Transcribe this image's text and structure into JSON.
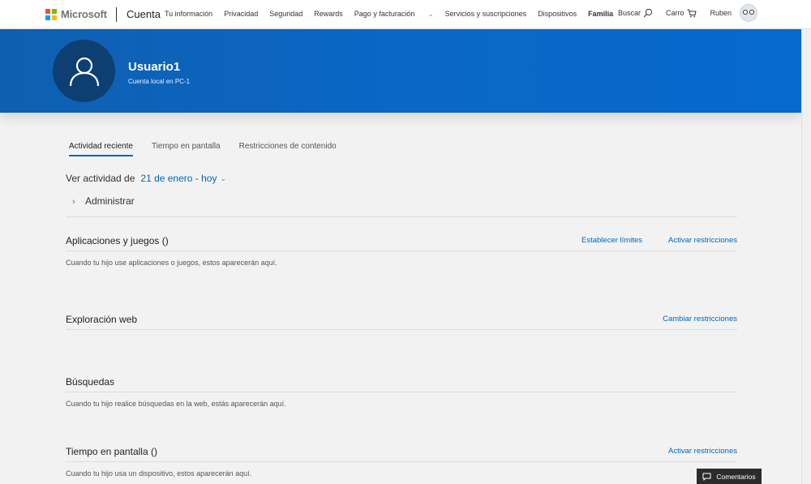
{
  "header": {
    "brand": "Microsoft",
    "section": "Cuenta",
    "nav_links": [
      {
        "label": "Tu información",
        "bold": false
      },
      {
        "label": "Privacidad",
        "bold": false
      },
      {
        "label": "Seguridad",
        "bold": false
      },
      {
        "label": "Rewards",
        "bold": false
      },
      {
        "label": "Pago y facturación",
        "bold": false,
        "dropdown": true
      },
      {
        "label": "Servicios y suscripciones",
        "bold": false
      },
      {
        "label": "Dispositivos",
        "bold": false
      },
      {
        "label": "Familia",
        "bold": true
      }
    ],
    "search_label": "Buscar",
    "cart_label": "Carro",
    "user_label": "Ruben",
    "icons": {
      "search": "search-icon",
      "cart": "cart-icon",
      "avatar": "avatar"
    }
  },
  "banner": {
    "name": "Usuario1",
    "subtitle": "Cuenta local en PC-1",
    "color": "#0a67c6"
  },
  "tabs": [
    {
      "label": "Actividad reciente",
      "active": true
    },
    {
      "label": "Tiempo en pantalla",
      "active": false
    },
    {
      "label": "Restricciones de contenido",
      "active": false
    }
  ],
  "activity": {
    "label": "Ver actividad de",
    "range": "21 de enero - hoy"
  },
  "admin": {
    "label": "Administrar"
  },
  "sections": {
    "apps": {
      "title": "Aplicaciones y juegos ()",
      "links": [
        "Establecer límites",
        "Activar restricciones"
      ],
      "body": "Cuando tu hijo use aplicaciones o juegos, estos aparecerán aquí."
    },
    "web": {
      "title": "Exploración web",
      "links": [
        "Cambiar restricciones"
      ],
      "body": ""
    },
    "search": {
      "title": "Búsquedas",
      "links": [],
      "body": "Cuando tu hijo realice búsquedas en la web, estás aparecerán aquí."
    },
    "screen": {
      "title": "Tiempo en pantalla ()",
      "links": [
        "Activar restricciones"
      ],
      "body": "Cuando tu hijo usa un dispositivo, estos aparecerán aquí."
    }
  },
  "feedback": {
    "label": "Comentarios"
  },
  "colors": {
    "accent": "#0067b8",
    "banner": "#0a67c6"
  }
}
